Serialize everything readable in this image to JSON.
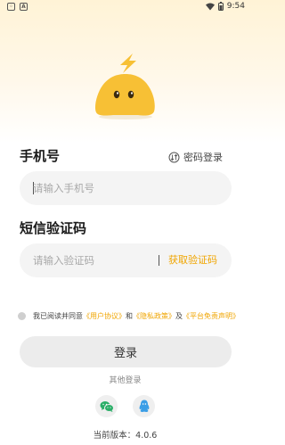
{
  "status_bar": {
    "time": "9:54"
  },
  "phone": {
    "title": "手机号",
    "placeholder": "请输入手机号",
    "password_login": "密码登录"
  },
  "code": {
    "title": "短信验证码",
    "placeholder": "请输入验证码",
    "get_code": "获取验证码"
  },
  "agreement": {
    "prefix": "我已阅读并同意",
    "user_agreement": "《用户协议》",
    "and1": "和",
    "privacy_policy": "《隐私政策》",
    "and2": "及",
    "disclaimer": "《平台免责声明》"
  },
  "login_button": "登录",
  "other_login": "其他登录",
  "version": "当前版本：4.0.6",
  "colors": {
    "accent": "#f0a500",
    "mascot": "#f7c035",
    "wechat": "#2aae67",
    "qq": "#3b9ee6"
  },
  "icons": [
    "wechat-icon",
    "qq-icon",
    "switch-icon",
    "wifi-icon",
    "battery-icon"
  ]
}
